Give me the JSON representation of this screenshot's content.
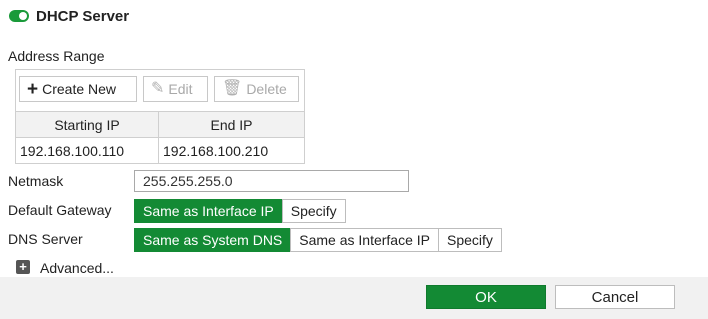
{
  "header": {
    "title": "DHCP Server",
    "enabled": true
  },
  "address_range": {
    "label": "Address Range",
    "toolbar": {
      "create": "Create New",
      "edit": "Edit",
      "delete": "Delete"
    },
    "columns": [
      "Starting IP",
      "End IP"
    ],
    "rows": [
      [
        "192.168.100.110",
        "192.168.100.210"
      ]
    ]
  },
  "netmask": {
    "label": "Netmask",
    "value": "255.255.255.0"
  },
  "default_gateway": {
    "label": "Default Gateway",
    "options": [
      "Same as Interface IP",
      "Specify"
    ],
    "selected": "Same as Interface IP"
  },
  "dns_server": {
    "label": "DNS Server",
    "options": [
      "Same as System DNS",
      "Same as Interface IP",
      "Specify"
    ],
    "selected": "Same as System DNS"
  },
  "advanced": {
    "label": "Advanced..."
  },
  "footer": {
    "ok": "OK",
    "cancel": "Cancel"
  },
  "colors": {
    "accent": "#138a34",
    "toggle_on": "#1a9a3a"
  }
}
